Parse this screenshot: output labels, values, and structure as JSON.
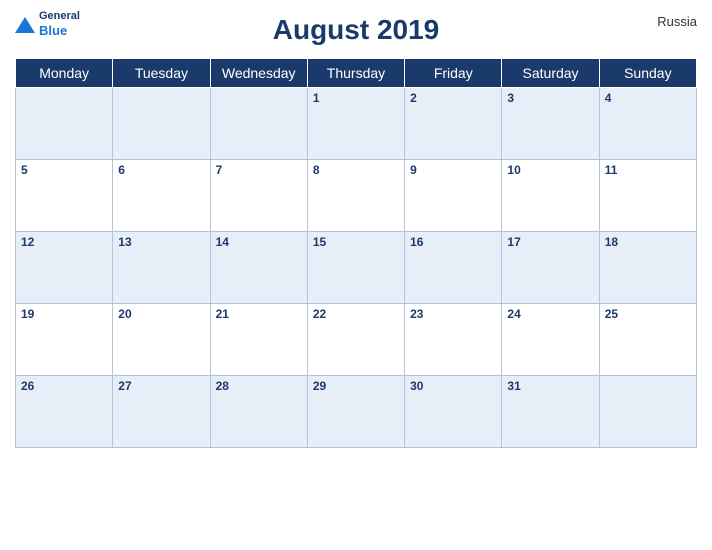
{
  "brand": {
    "general": "General",
    "blue": "Blue"
  },
  "country": "Russia",
  "title": "August 2019",
  "weekdays": [
    "Monday",
    "Tuesday",
    "Wednesday",
    "Thursday",
    "Friday",
    "Saturday",
    "Sunday"
  ],
  "weeks": [
    [
      null,
      null,
      null,
      1,
      2,
      3,
      4
    ],
    [
      5,
      6,
      7,
      8,
      9,
      10,
      11
    ],
    [
      12,
      13,
      14,
      15,
      16,
      17,
      18
    ],
    [
      19,
      20,
      21,
      22,
      23,
      24,
      25
    ],
    [
      26,
      27,
      28,
      29,
      30,
      31,
      null
    ]
  ]
}
